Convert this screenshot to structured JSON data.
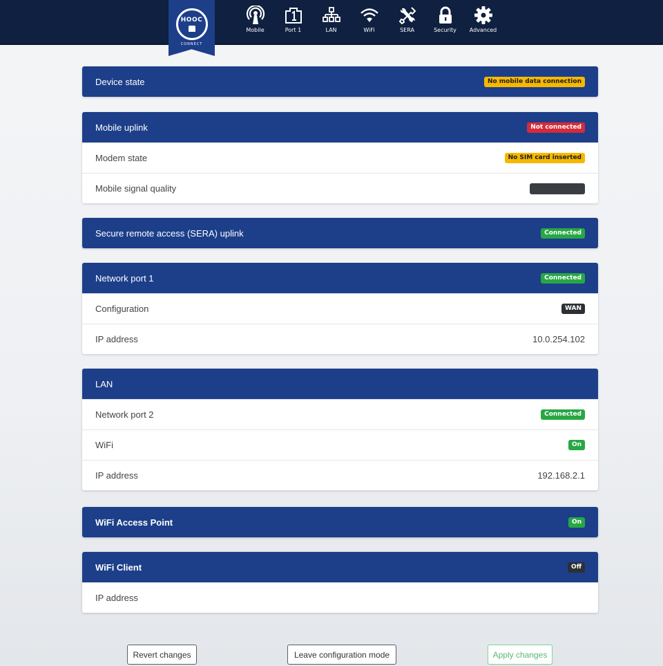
{
  "logo": {
    "text": "HOOC",
    "subtext": "CONNECT"
  },
  "nav": [
    {
      "label": "Mobile",
      "icon": "antenna-icon"
    },
    {
      "label": "Port 1",
      "icon": "port-icon"
    },
    {
      "label": "LAN",
      "icon": "network-icon"
    },
    {
      "label": "WiFi",
      "icon": "wifi-icon"
    },
    {
      "label": "SERA",
      "icon": "tools-icon"
    },
    {
      "label": "Security",
      "icon": "lock-icon"
    },
    {
      "label": "Advanced",
      "icon": "gear-icon"
    }
  ],
  "device_state": {
    "title": "Device state",
    "badge": "No mobile data connection"
  },
  "mobile_uplink": {
    "title": "Mobile uplink",
    "badge": "Not connected",
    "modem_label": "Modem state",
    "modem_badge": "No SIM card inserted",
    "signal_label": "Mobile signal quality"
  },
  "sera": {
    "title": "Secure remote access (SERA) uplink",
    "badge": "Connected"
  },
  "port1": {
    "title": "Network port 1",
    "badge": "Connected",
    "config_label": "Configuration",
    "config_badge": "WAN",
    "ip_label": "IP address",
    "ip_value": "10.0.254.102"
  },
  "lan": {
    "title": "LAN",
    "port2_label": "Network port 2",
    "port2_badge": "Connected",
    "wifi_label": "WiFi",
    "wifi_badge": "On",
    "ip_label": "IP address",
    "ip_value": "192.168.2.1"
  },
  "wifi_ap": {
    "title": "WiFi Access Point",
    "badge": "On"
  },
  "wifi_client": {
    "title": "WiFi Client",
    "badge": "Off",
    "ip_label": "IP address"
  },
  "buttons": {
    "revert": "Revert changes",
    "leave": "Leave configuration mode",
    "apply": "Apply changes"
  },
  "colors": {
    "topbar": "#0f2040",
    "card_header": "#1d3f8a",
    "warning": "#f6b800",
    "danger": "#d52b3a",
    "success": "#28a745",
    "dark": "#2c2f33"
  }
}
